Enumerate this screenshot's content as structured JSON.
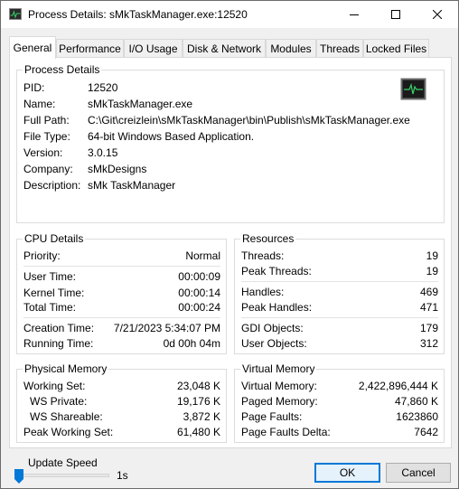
{
  "window": {
    "title": "Process Details: sMkTaskManager.exe:12520",
    "icons": {
      "app": "app-icon",
      "minimize": "minimize-icon",
      "maximize": "maximize-icon",
      "close": "close-icon"
    }
  },
  "tabs": [
    {
      "label": "General",
      "active": true
    },
    {
      "label": "Performance"
    },
    {
      "label": "I/O Usage"
    },
    {
      "label": "Disk & Network"
    },
    {
      "label": "Modules"
    },
    {
      "label": "Threads"
    },
    {
      "label": "Locked Files"
    }
  ],
  "process_details": {
    "title": "Process Details",
    "icon": "performance-monitor-icon",
    "rows": [
      {
        "label": "PID:",
        "value": "12520"
      },
      {
        "label": "Name:",
        "value": "sMkTaskManager.exe"
      },
      {
        "label": "Full Path:",
        "value": "C:\\Git\\creizlein\\sMkTaskManager\\bin\\Publish\\sMkTaskManager.exe"
      },
      {
        "label": "File Type:",
        "value": "64-bit Windows Based Application."
      },
      {
        "label": "Version:",
        "value": "3.0.15"
      },
      {
        "label": "Company:",
        "value": "sMkDesigns"
      },
      {
        "label": "Description:",
        "value": "sMk TaskManager"
      }
    ]
  },
  "cpu_details": {
    "title": "CPU Details",
    "priority": {
      "label": "Priority:",
      "value": "Normal"
    },
    "user_time": {
      "label": "User Time:",
      "value": "00:00:09"
    },
    "kernel_time": {
      "label": "Kernel Time:",
      "value": "00:00:14"
    },
    "total_time": {
      "label": "Total Time:",
      "value": "00:00:24"
    },
    "creation_time": {
      "label": "Creation Time:",
      "value": "7/21/2023 5:34:07 PM"
    },
    "running_time": {
      "label": "Running Time:",
      "value": "0d 00h 04m"
    }
  },
  "resources": {
    "title": "Resources",
    "threads": {
      "label": "Threads:",
      "value": "19"
    },
    "peak_threads": {
      "label": "Peak Threads:",
      "value": "19"
    },
    "handles": {
      "label": "Handles:",
      "value": "469"
    },
    "peak_handles": {
      "label": "Peak Handles:",
      "value": "471"
    },
    "gdi_objects": {
      "label": "GDI Objects:",
      "value": "179"
    },
    "user_objects": {
      "label": "User Objects:",
      "value": "312"
    }
  },
  "physical_memory": {
    "title": "Physical Memory",
    "working_set": {
      "label": "Working Set:",
      "value": "23,048 K"
    },
    "ws_private": {
      "label": "WS Private:",
      "value": "19,176 K"
    },
    "ws_shareable": {
      "label": "WS Shareable:",
      "value": "3,872 K"
    },
    "peak_working_set": {
      "label": "Peak Working Set:",
      "value": "61,480 K"
    }
  },
  "virtual_memory": {
    "title": "Virtual Memory",
    "virtual_memory": {
      "label": "Virtual Memory:",
      "value": "2,422,896,444 K"
    },
    "paged_memory": {
      "label": "Paged Memory:",
      "value": "47,860 K"
    },
    "page_faults": {
      "label": "Page Faults:",
      "value": "1623860"
    },
    "page_faults_delta": {
      "label": "Page Faults Delta:",
      "value": "7642"
    }
  },
  "footer": {
    "update_speed_label": "Update Speed",
    "update_speed_value": "1s",
    "update_speed_level": 0,
    "ok_label": "OK",
    "cancel_label": "Cancel"
  },
  "colors": {
    "accent": "#0078d7",
    "monitor_bg": "#1a1a1a",
    "monitor_line": "#37d36a"
  }
}
